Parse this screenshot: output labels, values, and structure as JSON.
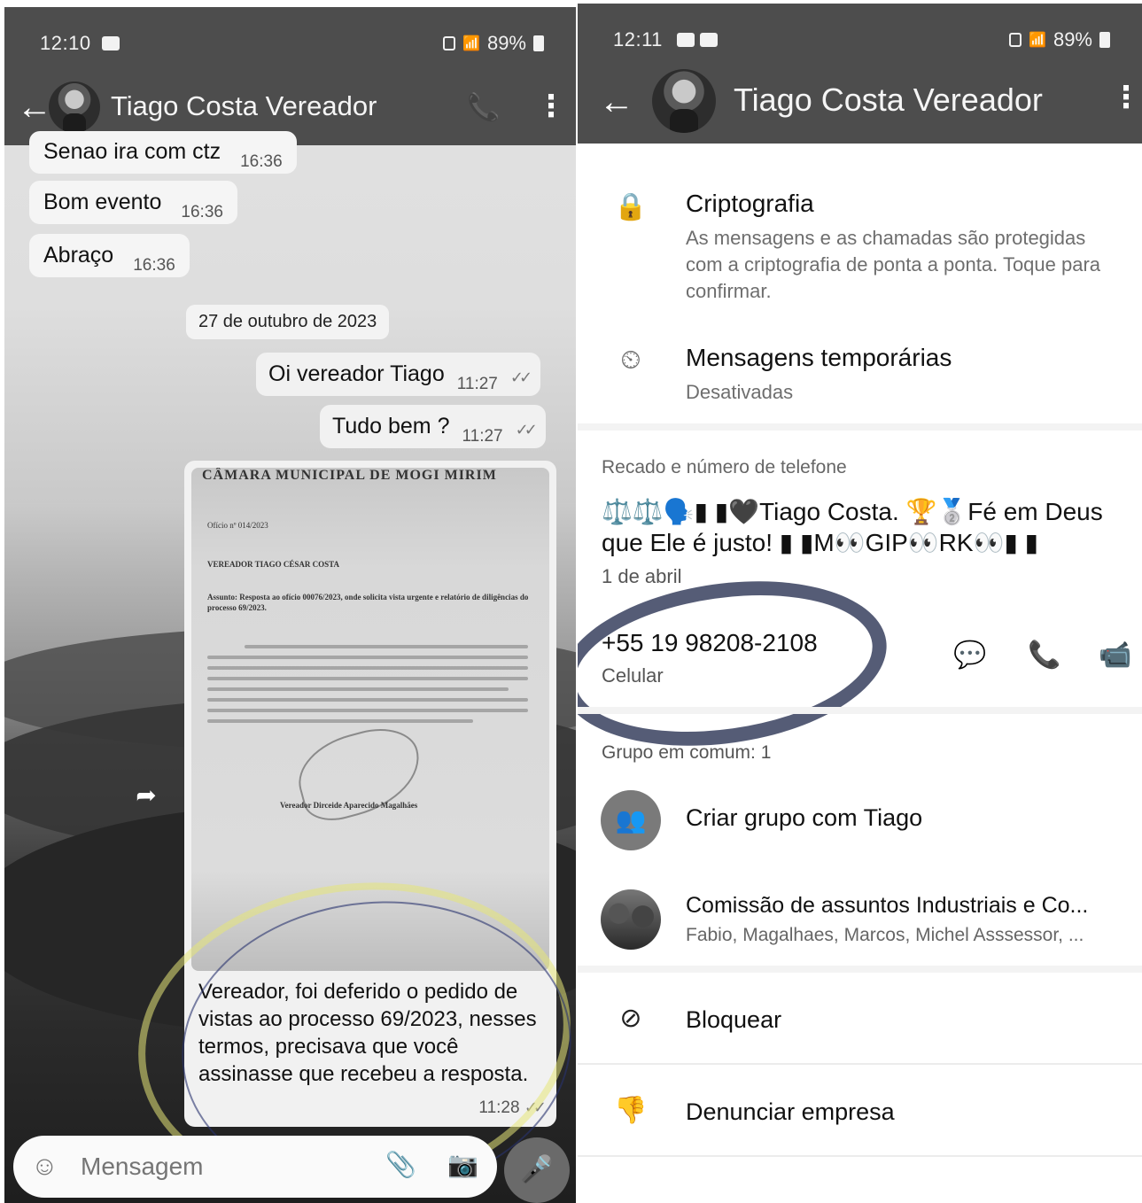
{
  "left": {
    "status": {
      "time": "12:10",
      "battery": "89%"
    },
    "header": {
      "contact_name": "Tiago Costa Vereador"
    },
    "messages": [
      {
        "text": "Senao ira com ctz",
        "time": "16:36"
      },
      {
        "text": "Bom evento",
        "time": "16:36"
      },
      {
        "text": "Abraço",
        "time": "16:36"
      }
    ],
    "date_separator": "27 de outubro de 2023",
    "outgoing": [
      {
        "text": "Oi vereador Tiago",
        "time": "11:27"
      },
      {
        "text": "Tudo bem ?",
        "time": "11:27"
      }
    ],
    "image_message": {
      "doc_header": "CÂMARA MUNICIPAL DE MOGI MIRIM",
      "doc_oficio": "Ofício nº 014/2023",
      "doc_to": "VEREADOR TIAGO CÉSAR COSTA",
      "doc_subject": "Assunto: Resposta ao ofício 00076/2023, onde solicita vista urgente e relatório de diligências do processo 69/2023.",
      "doc_signature": "Vereador Dirceide Aparecido Magalhães",
      "caption": "Vereador, foi deferido o pedido de vistas ao processo 69/2023, nesses termos, precisava que você assinasse que recebeu a resposta.",
      "time": "11:28"
    },
    "composer": {
      "placeholder": "Mensagem"
    },
    "ticks": "✓✓"
  },
  "right": {
    "status": {
      "time": "12:11",
      "battery": "89%"
    },
    "header": {
      "contact_name": "Tiago Costa Vereador"
    },
    "encryption": {
      "title": "Criptografia",
      "desc": "As mensagens e as chamadas são protegidas com a criptografia de ponta a ponta. Toque para confirmar."
    },
    "disappearing": {
      "title": "Mensagens temporárias",
      "value": "Desativadas"
    },
    "about_label": "Recado e número de telefone",
    "about_text": "⚖️⚖️🗣️▮ ▮🖤Tiago Costa. 🏆🥈Fé em Deus que Ele é justo! ▮ ▮M👀GIP👀RK👀▮ ▮",
    "about_date": "1 de abril",
    "phone": "+55 19 98208-2108",
    "phone_type": "Celular",
    "groups_label": "Grupo em comum: 1",
    "create_group": "Criar grupo com Tiago",
    "group": {
      "name": "Comissão de assuntos Industriais e Co...",
      "members": "Fabio, Magalhaes, Marcos, Michel Asssessor, ..."
    },
    "block": "Bloquear",
    "report": "Denunciar empresa"
  }
}
